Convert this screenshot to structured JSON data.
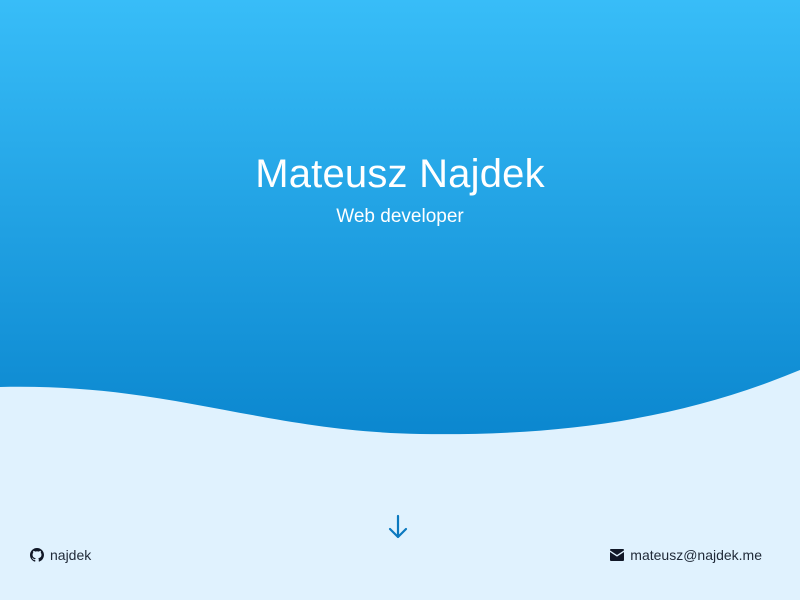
{
  "hero": {
    "name": "Mateusz Najdek",
    "subtitle": "Web developer"
  },
  "footer": {
    "github_label": "najdek",
    "email_label": "mateusz@najdek.me"
  },
  "icons": {
    "github": "github-icon",
    "email": "envelope-icon",
    "scroll": "arrow-down-icon"
  },
  "colors": {
    "gradient_top": "#38bdf8",
    "gradient_bottom": "#0b87cf",
    "background": "#e0f2fe",
    "arrow": "#0b79bf",
    "footer_text": "#1f2937"
  }
}
